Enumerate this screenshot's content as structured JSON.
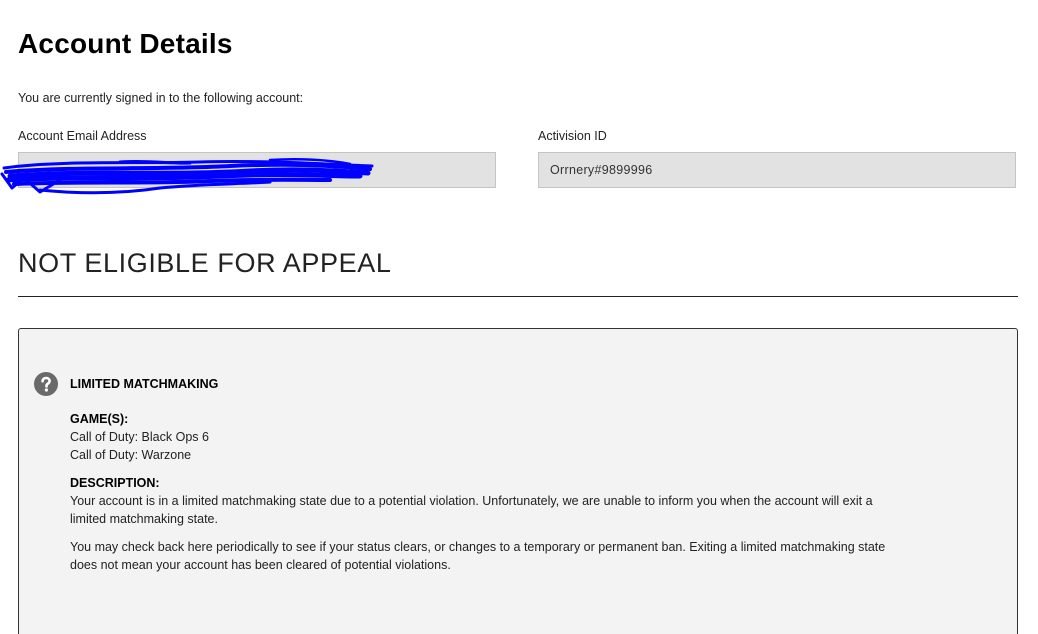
{
  "header": {
    "title": "Account Details",
    "intro": "You are currently signed in to the following account:"
  },
  "fields": {
    "email": {
      "label": "Account Email Address",
      "value": ""
    },
    "activision_id": {
      "label": "Activision ID",
      "value": "Orrnery#9899996"
    }
  },
  "appeal": {
    "heading": "NOT ELIGIBLE FOR APPEAL"
  },
  "status_card": {
    "icon": "question-circle-icon",
    "title": "LIMITED MATCHMAKING",
    "games_label": "GAME(S):",
    "games": [
      "Call of Duty: Black Ops 6",
      "Call of Duty: Warzone"
    ],
    "description_label": "DESCRIPTION:",
    "description": [
      "Your account is in a limited matchmaking state due to a potential violation. Unfortunately, we are unable to inform you when the account will exit a limited matchmaking state.",
      "You may check back here periodically to see if your status clears, or changes to a temporary or permanent ban. Exiting a limited matchmaking state does not mean your account has been cleared of potential violations."
    ]
  },
  "colors": {
    "field_background": "#e2e2e2",
    "card_background": "#f3f3f3",
    "redaction_ink": "#0000ff",
    "icon": "#6a6a6a"
  }
}
